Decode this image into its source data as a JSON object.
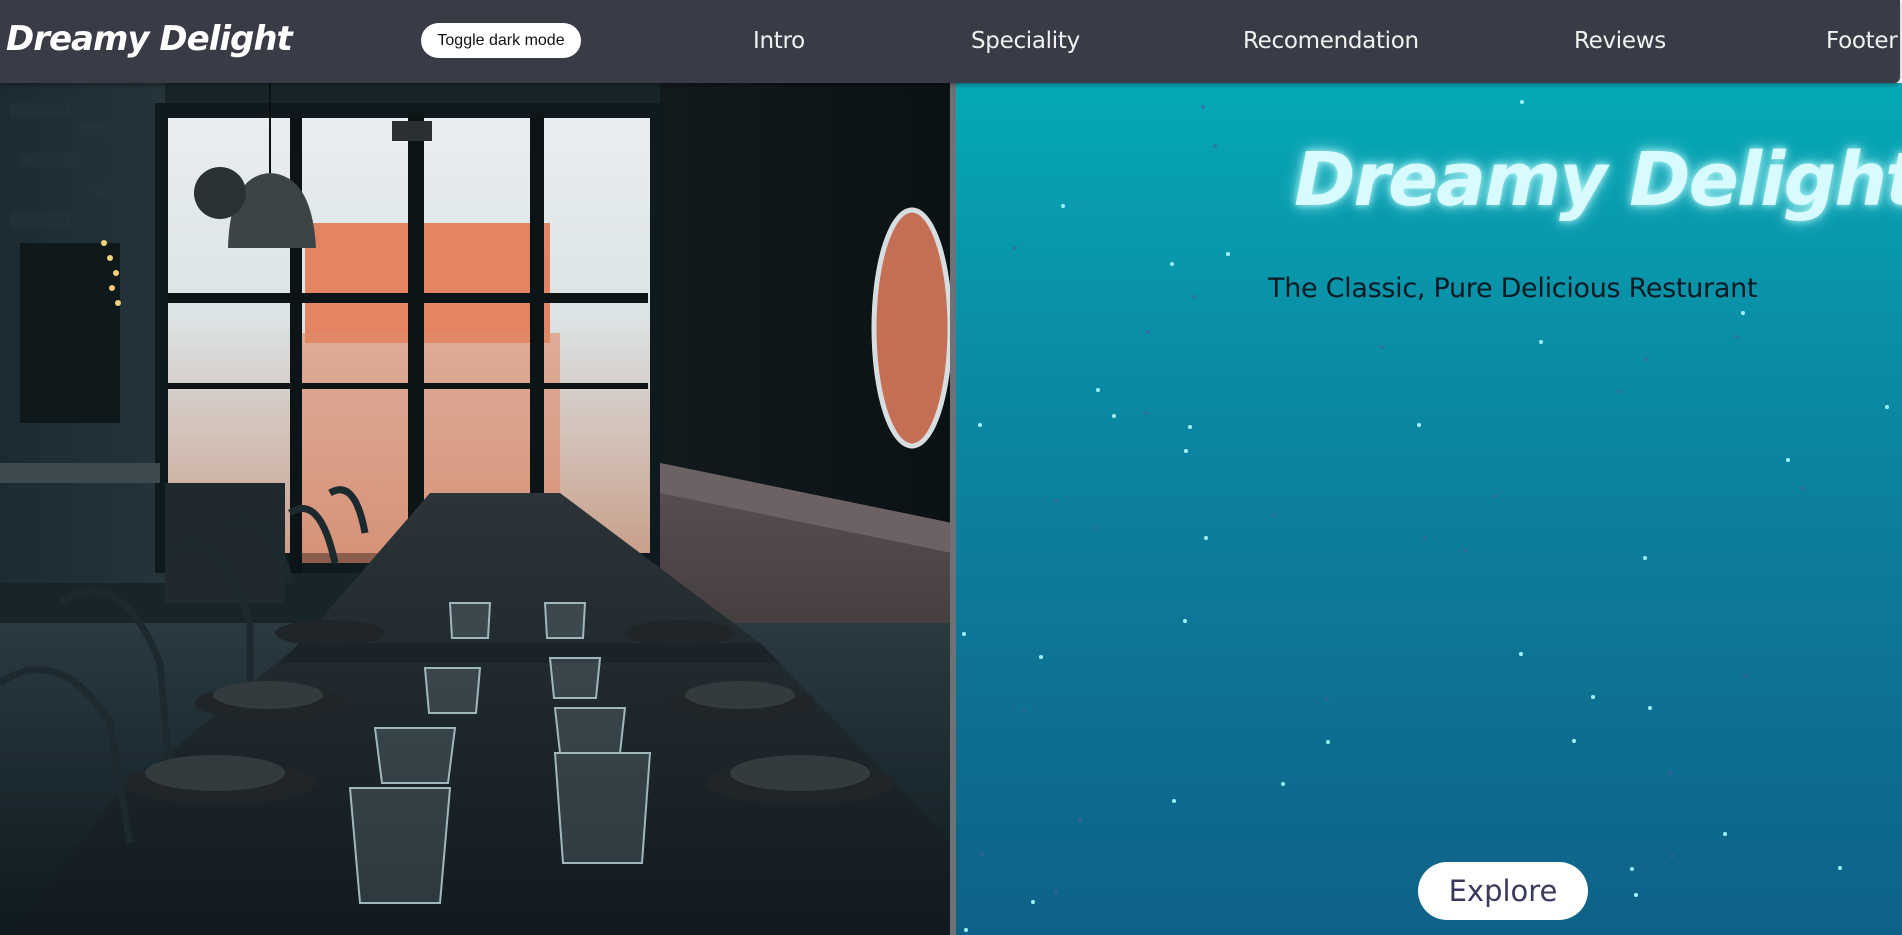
{
  "navbar": {
    "brand": "Dreamy Delight",
    "toggle_label": "Toggle dark mode",
    "links": [
      "Intro",
      "Speciality",
      "Recomendation",
      "Reviews",
      "Footer"
    ]
  },
  "hero": {
    "title": "Dreamy Delight",
    "subtitle": "The Classic, Pure Delicious Resturant",
    "explore_label": "Explore"
  },
  "colors": {
    "navbar_bg": "#393c46",
    "hero_gradient_top": "#05a9b6",
    "hero_gradient_bottom": "#0f6187",
    "title_glow": "#d8fbff",
    "button_bg": "#ffffff"
  },
  "icons": {
    "restaurant_photo": "restaurant-interior-photo",
    "starfield": "particle-dots"
  }
}
